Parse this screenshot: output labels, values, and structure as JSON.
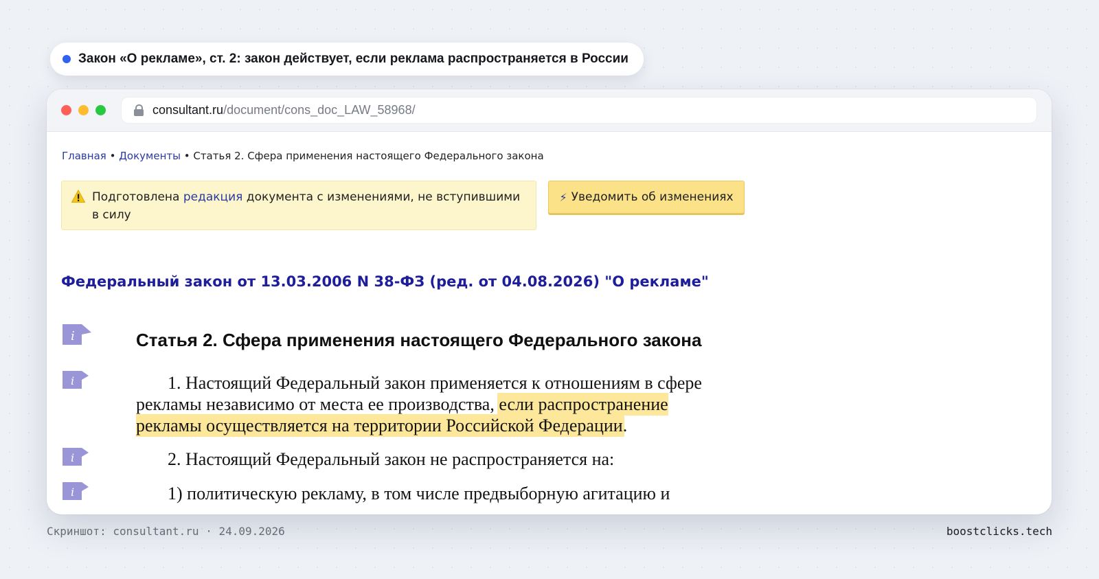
{
  "header_pill": {
    "text": "Закон «О рекламе», ст. 2: закон действует, если реклама распространяется в России",
    "dot_color": "#2f62f0"
  },
  "browser": {
    "traffic_lights": [
      "#ff5f57",
      "#febc2e",
      "#28c840"
    ],
    "url_domain": "consultant.ru",
    "url_path": "/document/cons_doc_LAW_58968/",
    "lock_icon": "lock-icon"
  },
  "breadcrumb": {
    "home": "Главная",
    "sep1": " • ",
    "docs": "Документы",
    "sep2": " • ",
    "current": "Статья 2. Сфера применения настоящего Федерального закона"
  },
  "notice": {
    "text_before": "Подготовлена ",
    "link": "редакция",
    "text_after": " документа с изменениями, не вступившими в силу",
    "icon": "warning-icon"
  },
  "notify_button": {
    "icon": "bolt-icon",
    "label": "Уведомить об изменениях"
  },
  "law_title": "Федеральный закон от 13.03.2006 N 38-ФЗ (ред. от 04.08.2026) \"О рекламе\"",
  "article": {
    "heading": "Статья 2. Сфера применения настоящего Федерального закона",
    "p1_before": "1. Настоящий Федеральный закон применяется к отношениям в сфере рекламы независимо от места ее производства, ",
    "p1_highlight": "если распространение рекламы осуществляется на территории Российской Федерации",
    "p1_after": ".",
    "p2": "2. Настоящий Федеральный закон не распространяется на:",
    "p3": "1) политическую рекламу, в том числе предвыборную агитацию и"
  },
  "caption": {
    "left": "Скриншот: consultant.ru · 24.09.2026",
    "right": "boostclicks.tech"
  },
  "colors": {
    "link": "#2a3aa0",
    "title": "#1e1e9a",
    "highlight": "#fde79a",
    "info_icon": "#9a95d6"
  }
}
